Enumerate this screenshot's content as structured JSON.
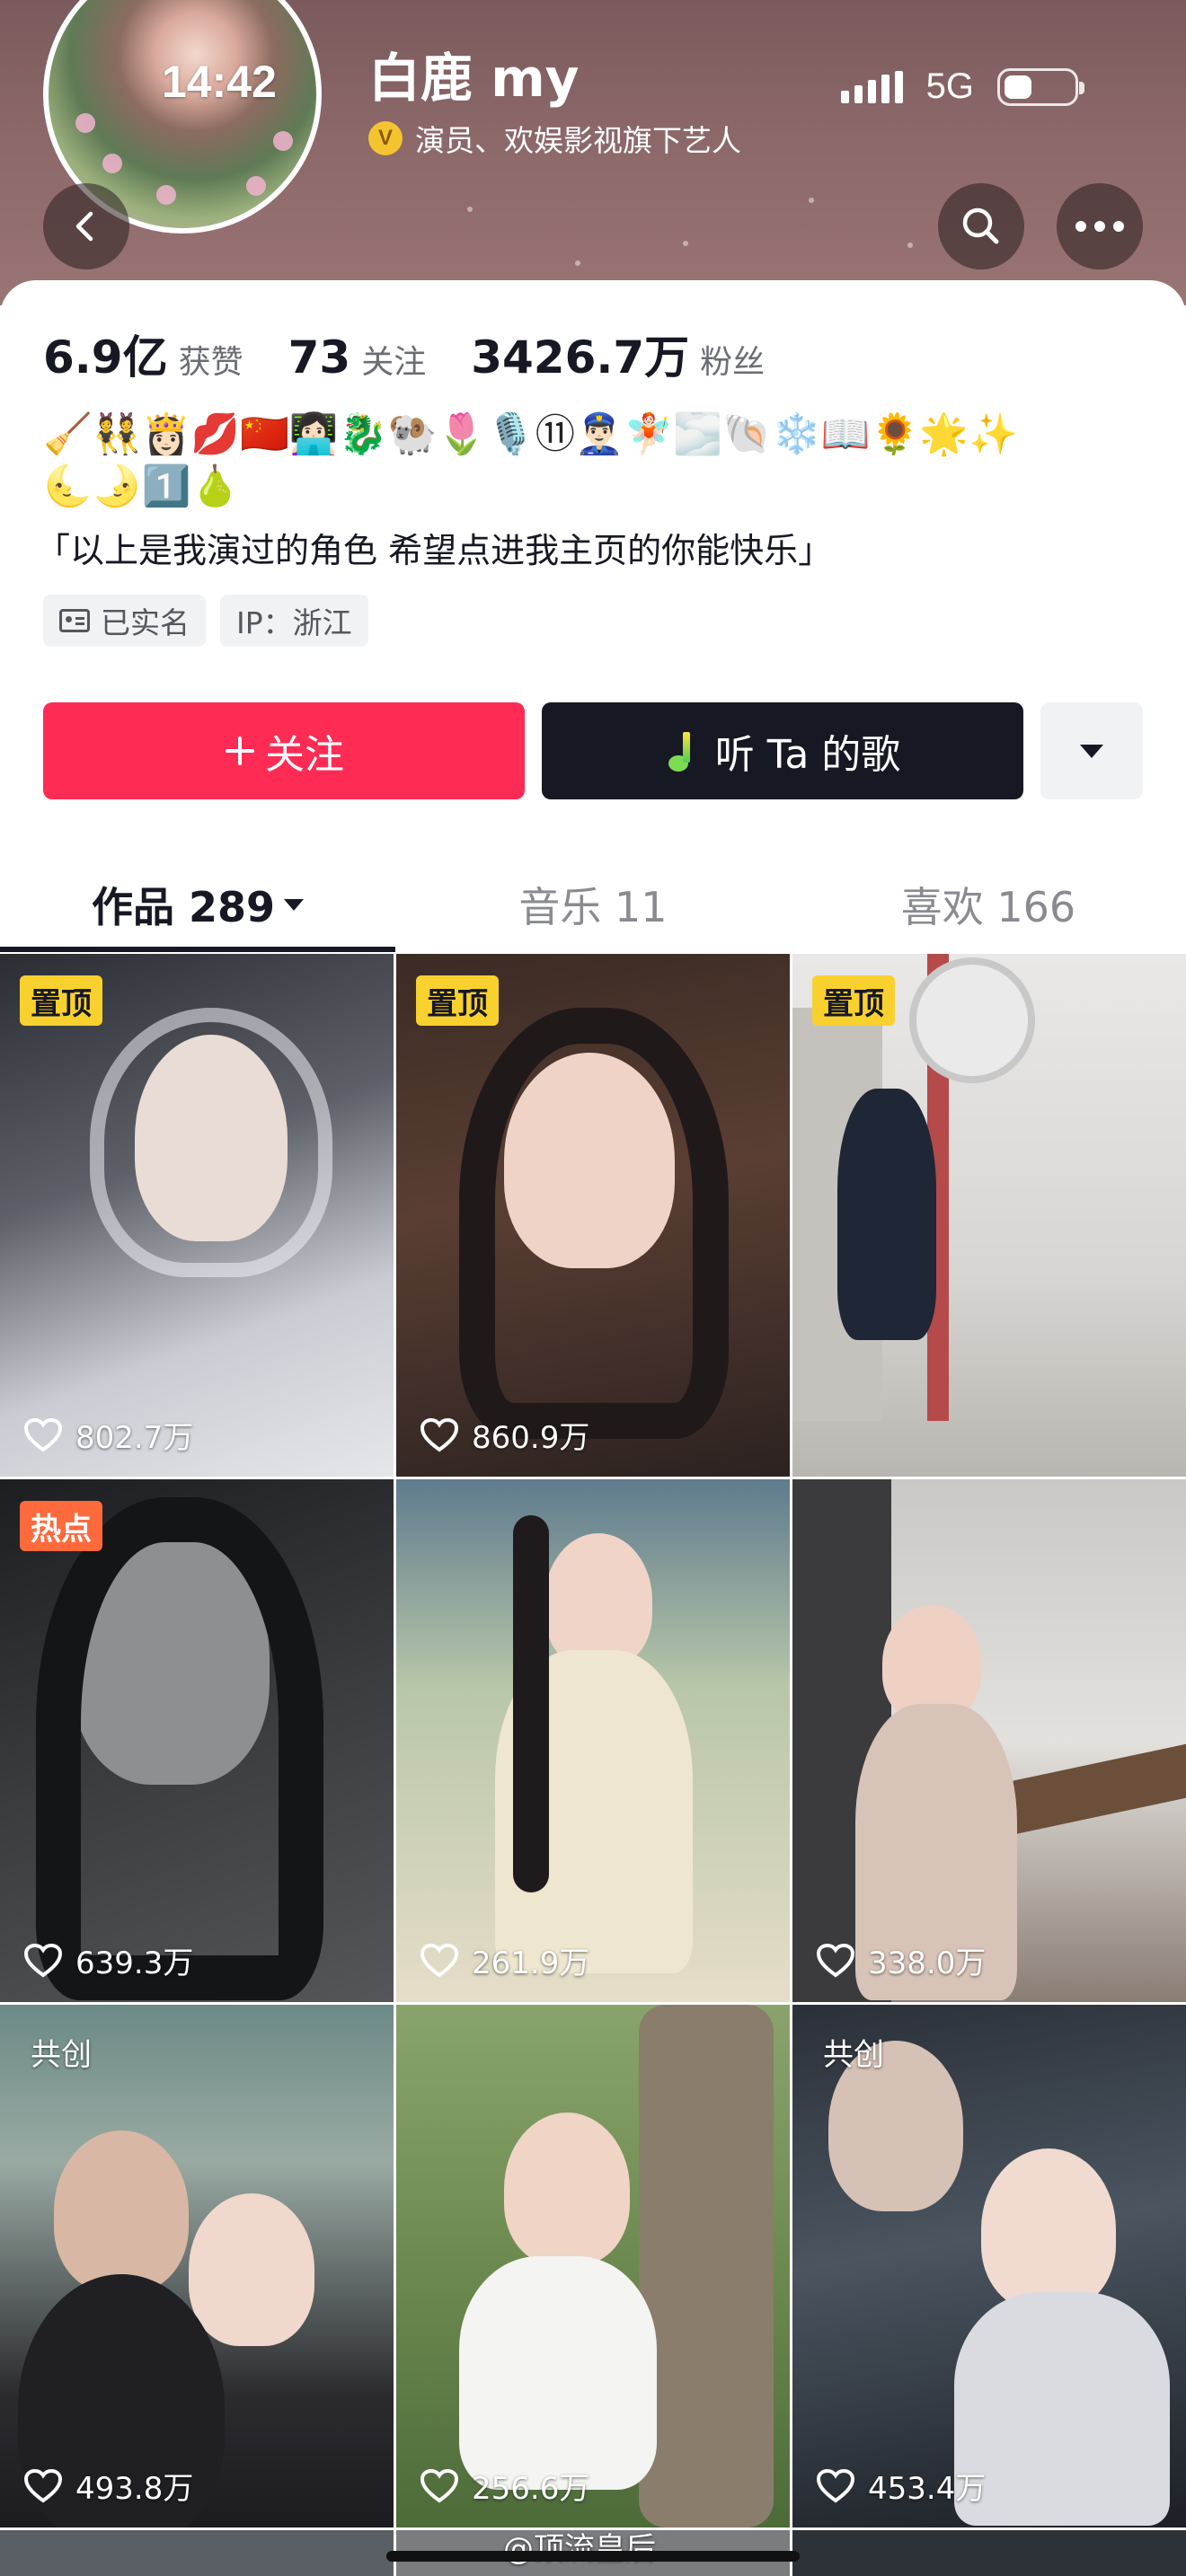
{
  "status_bar": {
    "time": "14:42",
    "network": "5G",
    "battery_percent": 40
  },
  "profile": {
    "name": "白鹿 my",
    "verification": "演员、欢娱影视旗下艺人",
    "verify_badge": "V",
    "stats": [
      {
        "value": "6.9亿",
        "label": "获赞"
      },
      {
        "value": "73",
        "label": "关注"
      },
      {
        "value": "3426.7万",
        "label": "粉丝"
      }
    ],
    "emoji_line_1": "🧹👯👸🏻💋🇨🇳👩🏻‍💻🐉🐏🌷🎙️⑪👮🏻‍♂️🧚🏻🌫️🐚❄️📖🌻🌟✨",
    "emoji_line_2": "🌜🌛1️⃣🍐",
    "bio": "「以上是我演过的角色 希望点进我主页的你能快乐」",
    "tags": {
      "real_name": "已实名",
      "ip": "IP：浙江"
    }
  },
  "actions": {
    "follow": "关注",
    "music": "听 Ta 的歌"
  },
  "tabs": [
    {
      "label": "作品 289",
      "active": true
    },
    {
      "label": "音乐 11",
      "active": false
    },
    {
      "label": "喜欢 166",
      "active": false
    }
  ],
  "videos": [
    {
      "badge": "置顶",
      "badge_type": "pin",
      "likes": "802.7万"
    },
    {
      "badge": "置顶",
      "badge_type": "pin",
      "likes": "860.9万"
    },
    {
      "badge": "置顶",
      "badge_type": "pin",
      "likes": ""
    },
    {
      "badge": "热点",
      "badge_type": "hot",
      "likes": "639.3万"
    },
    {
      "badge": "",
      "badge_type": "",
      "likes": "261.9万"
    },
    {
      "badge": "",
      "badge_type": "",
      "likes": "338.0万"
    },
    {
      "badge": "共创",
      "badge_type": "co",
      "likes": "493.8万"
    },
    {
      "badge": "",
      "badge_type": "",
      "likes": "256.6万"
    },
    {
      "badge": "共创",
      "badge_type": "co",
      "likes": "453.4万"
    }
  ],
  "watermark": "@顶流皇后",
  "colors": {
    "primary": "#fe2c55",
    "dark": "#161823",
    "pin": "#f8d12f",
    "hot": "#fe6a3c"
  }
}
